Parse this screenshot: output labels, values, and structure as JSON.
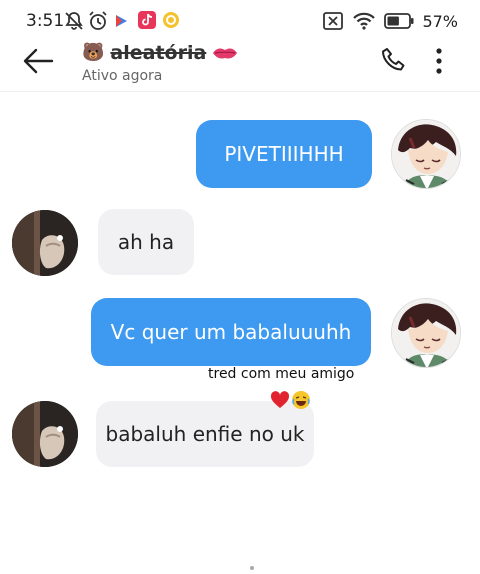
{
  "status_bar": {
    "time": "3:51",
    "battery_percent": "57%",
    "battery_level": 0.57,
    "icons": [
      "bell-off-icon",
      "alarm-icon",
      "play-icon",
      "tiktok-icon",
      "yellow-app-icon",
      "no-sim-icon",
      "wifi-icon",
      "battery-icon"
    ]
  },
  "header": {
    "name_prefix_emoji": "🐻",
    "contact_name": "aleatória",
    "name_suffix_icon": "lips-icon",
    "status": "Ativo agora"
  },
  "messages": [
    {
      "side": "sent",
      "text": "PIVETIIIHHH"
    },
    {
      "side": "received",
      "text": "ah ha"
    },
    {
      "side": "sent",
      "text": "Vc quer um babaluuuhh"
    },
    {
      "side": "received",
      "text": "babaluh enfie no uk"
    }
  ],
  "overlay": {
    "caption": "tred com meu amigo",
    "emojis": [
      "heart-emoji",
      "laughing-emoji"
    ]
  },
  "colors": {
    "sent_bubble": "#3d9af0",
    "received_bubble": "#f1f1f3",
    "header_text": "#333333"
  }
}
